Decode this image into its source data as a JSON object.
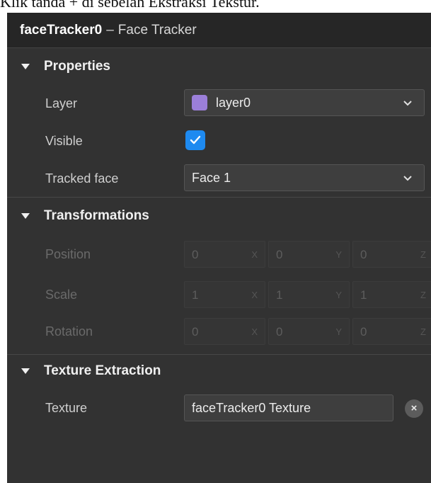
{
  "caption": "Klik tanda + di sebelah Ekstraksi Tekstur.",
  "header": {
    "object_name": "faceTracker0",
    "separator": "–",
    "object_type": "Face Tracker"
  },
  "sections": {
    "properties": {
      "title": "Properties",
      "layer": {
        "label": "Layer",
        "value": "layer0",
        "swatch_color": "#9b7fd9"
      },
      "visible": {
        "label": "Visible",
        "checked": true
      },
      "tracked_face": {
        "label": "Tracked face",
        "value": "Face 1"
      }
    },
    "transformations": {
      "title": "Transformations",
      "position": {
        "label": "Position",
        "x": "0",
        "y": "0",
        "z": "0"
      },
      "scale": {
        "label": "Scale",
        "x": "1",
        "y": "1",
        "z": "1"
      },
      "rotation": {
        "label": "Rotation",
        "x": "0",
        "y": "0",
        "z": "0"
      },
      "axis_labels": {
        "x": "X",
        "y": "Y",
        "z": "Z"
      }
    },
    "texture_extraction": {
      "title": "Texture Extraction",
      "texture": {
        "label": "Texture",
        "value": "faceTracker0 Texture"
      },
      "clear_symbol": "×"
    }
  },
  "colors": {
    "panel_bg": "#323232",
    "header_bg": "#262626",
    "accent": "#1e8af0"
  }
}
